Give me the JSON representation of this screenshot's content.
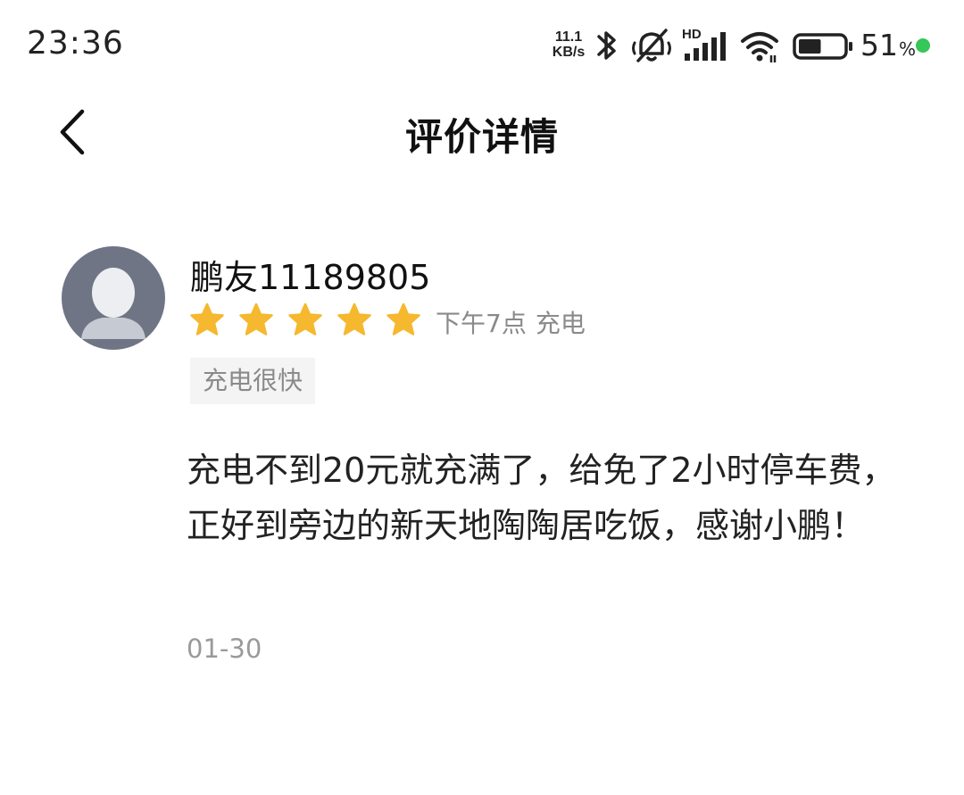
{
  "status_bar": {
    "time": "23:36",
    "net_speed_value": "11.1",
    "net_speed_unit": "KB/s",
    "signal_label": "HD",
    "battery_percent": "51",
    "battery_percent_sign": "%",
    "battery_level": 0.51,
    "charging_color": "#35c759"
  },
  "header": {
    "title": "评价详情",
    "back_icon": "chevron-left-icon"
  },
  "review": {
    "username": "鹏友11189805",
    "rating": 5,
    "rating_max": 5,
    "star_color": "#f5b82e",
    "time_of_day": "下午7点",
    "service_type": "充电",
    "tag": "充电很快",
    "text": "充电不到20元就充满了，给免了2小时停车费，正好到旁边的新天地陶陶居吃饭，感谢小鹏！",
    "date": "01-30"
  }
}
